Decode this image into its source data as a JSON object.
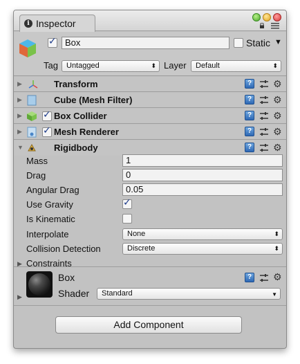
{
  "window": {
    "tab_label": "Inspector",
    "traffic_lights": [
      "#4aa82a",
      "#e0a31c",
      "#d63a3a"
    ]
  },
  "gameobject": {
    "name": "Box",
    "active": true,
    "static_label": "Static",
    "static_checked": false,
    "tag_label": "Tag",
    "tag_value": "Untagged",
    "layer_label": "Layer",
    "layer_value": "Default"
  },
  "components": [
    {
      "title": "Transform",
      "icon": "transform-icon",
      "has_checkbox": false
    },
    {
      "title": "Cube (Mesh Filter)",
      "icon": "mesh-filter-icon",
      "has_checkbox": false
    },
    {
      "title": "Box Collider",
      "icon": "box-collider-icon",
      "has_checkbox": true,
      "checked": true
    },
    {
      "title": "Mesh Renderer",
      "icon": "mesh-renderer-icon",
      "has_checkbox": true,
      "checked": true
    },
    {
      "title": "Rigidbody",
      "icon": "rigidbody-icon",
      "has_checkbox": false,
      "expanded": true
    }
  ],
  "rigidbody": {
    "mass_label": "Mass",
    "mass": "1",
    "drag_label": "Drag",
    "drag": "0",
    "angular_drag_label": "Angular Drag",
    "angular_drag": "0.05",
    "use_gravity_label": "Use Gravity",
    "use_gravity": true,
    "is_kinematic_label": "Is Kinematic",
    "is_kinematic": false,
    "interpolate_label": "Interpolate",
    "interpolate": "None",
    "collision_label": "Collision Detection",
    "collision": "Discrete",
    "constraints_label": "Constraints"
  },
  "material": {
    "name": "Box",
    "shader_label": "Shader",
    "shader": "Standard"
  },
  "add_component_label": "Add Component"
}
